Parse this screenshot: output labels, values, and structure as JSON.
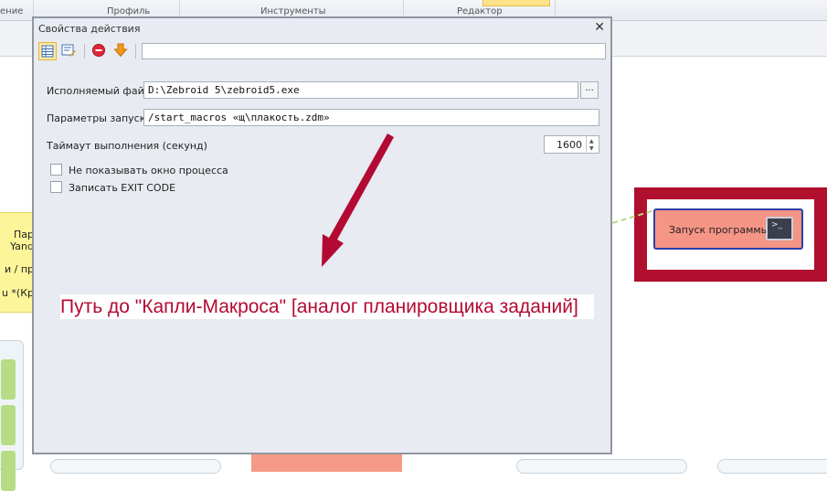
{
  "ribbon": {
    "groups": [
      "ение",
      "Профиль",
      "Инструменты",
      "Редактор"
    ]
  },
  "background": {
    "yellow_node_lines": [
      "Пар",
      "Yand",
      "и / пр",
      "u *(Кр"
    ],
    "program_node_label": "Запуск программы",
    "program_node_icon": "terminal-icon"
  },
  "dialog": {
    "title": "Свойства действия",
    "close_icon": "close-icon",
    "toolbar": {
      "icons": [
        "table-view-icon",
        "edit-properties-icon",
        "stop-icon",
        "arrow-down-icon"
      ],
      "search_value": ""
    },
    "executable": {
      "label": "Исполняемый файл",
      "value": "D:\\Zebroid 5\\zebroid5.exe",
      "browse_label": "..."
    },
    "params": {
      "label": "Параметры запуска",
      "value": "/start_macros «щ\\плакость.zdm»"
    },
    "timeout": {
      "label": "Таймаут выполнения (секунд)",
      "value": "1600"
    },
    "checkboxes": [
      {
        "label": "Не показывать окно процесса",
        "checked": false
      },
      {
        "label": "Записать EXIT CODE",
        "checked": false
      }
    ]
  },
  "annotation": {
    "text": "Путь до \"Капли-Макроса\" [аналог планировщика заданий]",
    "color": "#b30a34"
  },
  "colors": {
    "highlight_frame": "#b10f2e",
    "program_node": "#f59585"
  }
}
